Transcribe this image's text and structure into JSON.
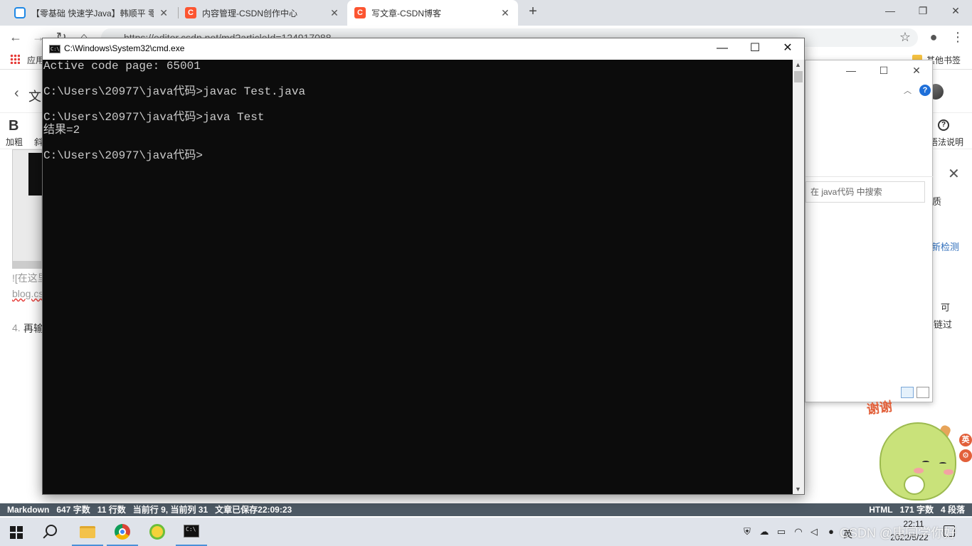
{
  "browser": {
    "tabs": [
      {
        "label": "【零基础 快速学Java】韩顺平 零",
        "favicon": "bilibili-icon",
        "active": false
      },
      {
        "label": "内容管理-CSDN创作中心",
        "favicon": "csdn-icon",
        "active": false
      },
      {
        "label": "写文章-CSDN博客",
        "favicon": "csdn-icon",
        "active": true
      }
    ],
    "url": "https://editor.csdn.net/md?articleId=124917088",
    "bookmarks": {
      "apps_label": "应用",
      "other_label": "其他书签"
    }
  },
  "editor": {
    "page_title_fragment": "文",
    "toolbar": {
      "bold_glyph": "B",
      "bold_label": "加粗",
      "italic_label_fragment": "斜",
      "help_label_fragment": "语法说明"
    },
    "content_fragments": {
      "image_markup": "![在这里",
      "url_fragment": "blog.cs",
      "list_number": "4.",
      "list_text": "再输"
    },
    "right_panel": {
      "frag_quality": "质",
      "frag_detect": "新检测",
      "frag_can": "可",
      "frag_link": "链过"
    },
    "status_left": {
      "mode": "Markdown",
      "chars": "647 字数",
      "lines": "11 行数",
      "cursor": "当前行 9, 当前列 31",
      "saved": "文章已保存22:09:23"
    },
    "status_right": {
      "mode": "HTML",
      "chars": "171 字数",
      "paragraphs": "4 段落"
    }
  },
  "explorer": {
    "search_placeholder": "在 java代码 中搜索"
  },
  "cmd": {
    "title": "C:\\Windows\\System32\\cmd.exe",
    "lines": [
      "Active code page: 65001",
      "",
      "C:\\Users\\20977\\java代码>javac Test.java",
      "",
      "C:\\Users\\20977\\java代码>java Test",
      "结果=2",
      "",
      "C:\\Users\\20977\\java代码>"
    ]
  },
  "sticker": {
    "text": "谢谢",
    "badge": "英"
  },
  "taskbar": {
    "apps": [
      "start-icon",
      "search-icon",
      "file-explorer-icon",
      "chrome-icon",
      "green-app-icon",
      "cmd-icon"
    ],
    "tray": {
      "lang": "英",
      "time": "22:11",
      "date": "2022/5/22"
    },
    "watermark": "CSDN @唐同学你好"
  },
  "colors": {
    "console_bg": "#0c0c0c",
    "console_text": "#cccccc",
    "csdn_red": "#fc5531",
    "statusbar": "#4e5a65",
    "taskbar": "#dfe3ea"
  }
}
